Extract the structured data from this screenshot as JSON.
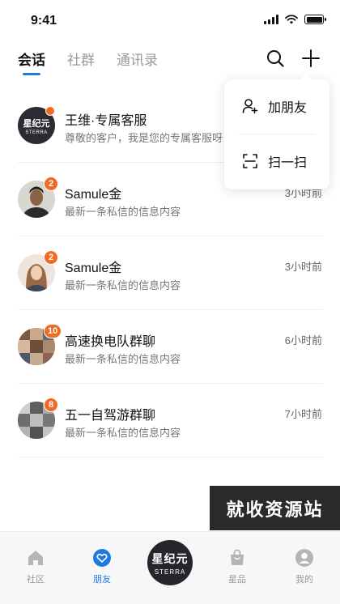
{
  "status": {
    "time": "9:41"
  },
  "tabs": [
    {
      "label": "会话",
      "active": true
    },
    {
      "label": "社群",
      "active": false
    },
    {
      "label": "通讯录",
      "active": false
    }
  ],
  "menu": {
    "items": [
      {
        "label": "加朋友",
        "icon": "add-user-icon"
      },
      {
        "label": "扫一扫",
        "icon": "scan-icon"
      }
    ]
  },
  "conversations": [
    {
      "title": "王维·专属客服",
      "preview": "尊敬的客户，我是您的专属客服呀",
      "time": "",
      "badge": "",
      "avatar": {
        "logo_main": "星纪元",
        "logo_sub": "STERRA"
      }
    },
    {
      "title": "Samule金",
      "preview": "最新一条私信的信息内容",
      "time": "3小时前",
      "badge": "2"
    },
    {
      "title": "Samule金",
      "preview": "最新一条私信的信息内容",
      "time": "3小时前",
      "badge": "2"
    },
    {
      "title": "高速换电队群聊",
      "preview": "最新一条私信的信息内容",
      "time": "6小时前",
      "badge": "10"
    },
    {
      "title": "五一自驾游群聊",
      "preview": "最新一条私信的信息内容",
      "time": "7小时前",
      "badge": "8"
    }
  ],
  "watermark": "就收资源站",
  "nav": {
    "items": [
      {
        "label": "社区",
        "icon": "home-icon"
      },
      {
        "label": "朋友",
        "icon": "friends-icon",
        "active": true
      },
      {
        "label": "星品",
        "icon": "shopping-bag-icon"
      },
      {
        "label": "我的",
        "icon": "profile-icon"
      }
    ],
    "center_logo": {
      "main": "星纪元",
      "sub": "STERRA"
    }
  },
  "colors": {
    "accent": "#1f7ae0",
    "badge": "#f06a22",
    "logo_bg": "#27242e"
  }
}
